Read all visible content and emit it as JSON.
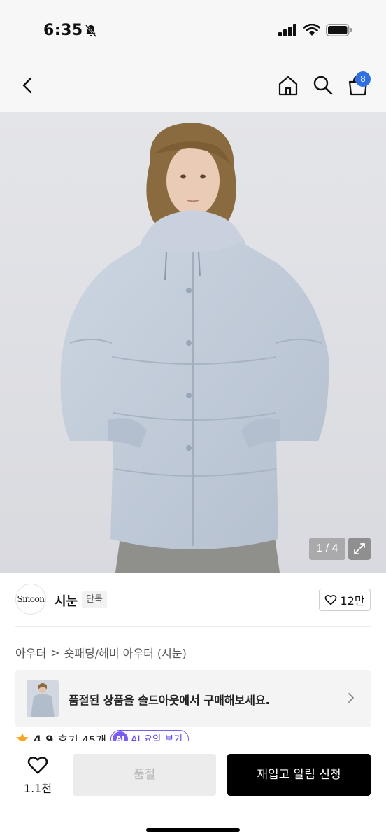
{
  "status_bar": {
    "time": "6:35"
  },
  "nav": {
    "cart_count": "8"
  },
  "product_image": {
    "counter": "1 / 4"
  },
  "brand": {
    "logo_text": "Sinoon",
    "name": "시눈",
    "tag": "단독",
    "likes": "12만"
  },
  "breadcrumb": {
    "category": "아우터",
    "separator": ">",
    "subcategory": "숏패딩/헤비 아우터 (시눈)"
  },
  "banner": {
    "text": "품절된 상품을 솔드아웃에서 구매해보세요."
  },
  "rating": {
    "value": "4.9",
    "reviews": "후기 45개",
    "ai_label": "AI",
    "ai_summary": "AI 요약 보기"
  },
  "bottom_bar": {
    "wish_count": "1.1천",
    "soldout_label": "품절",
    "restock_label": "재입고 알림 신청"
  },
  "colors": {
    "accent_blue": "#2f6fe4",
    "ai_purple": "#7b5cf0",
    "jacket": "#c4cedb"
  }
}
